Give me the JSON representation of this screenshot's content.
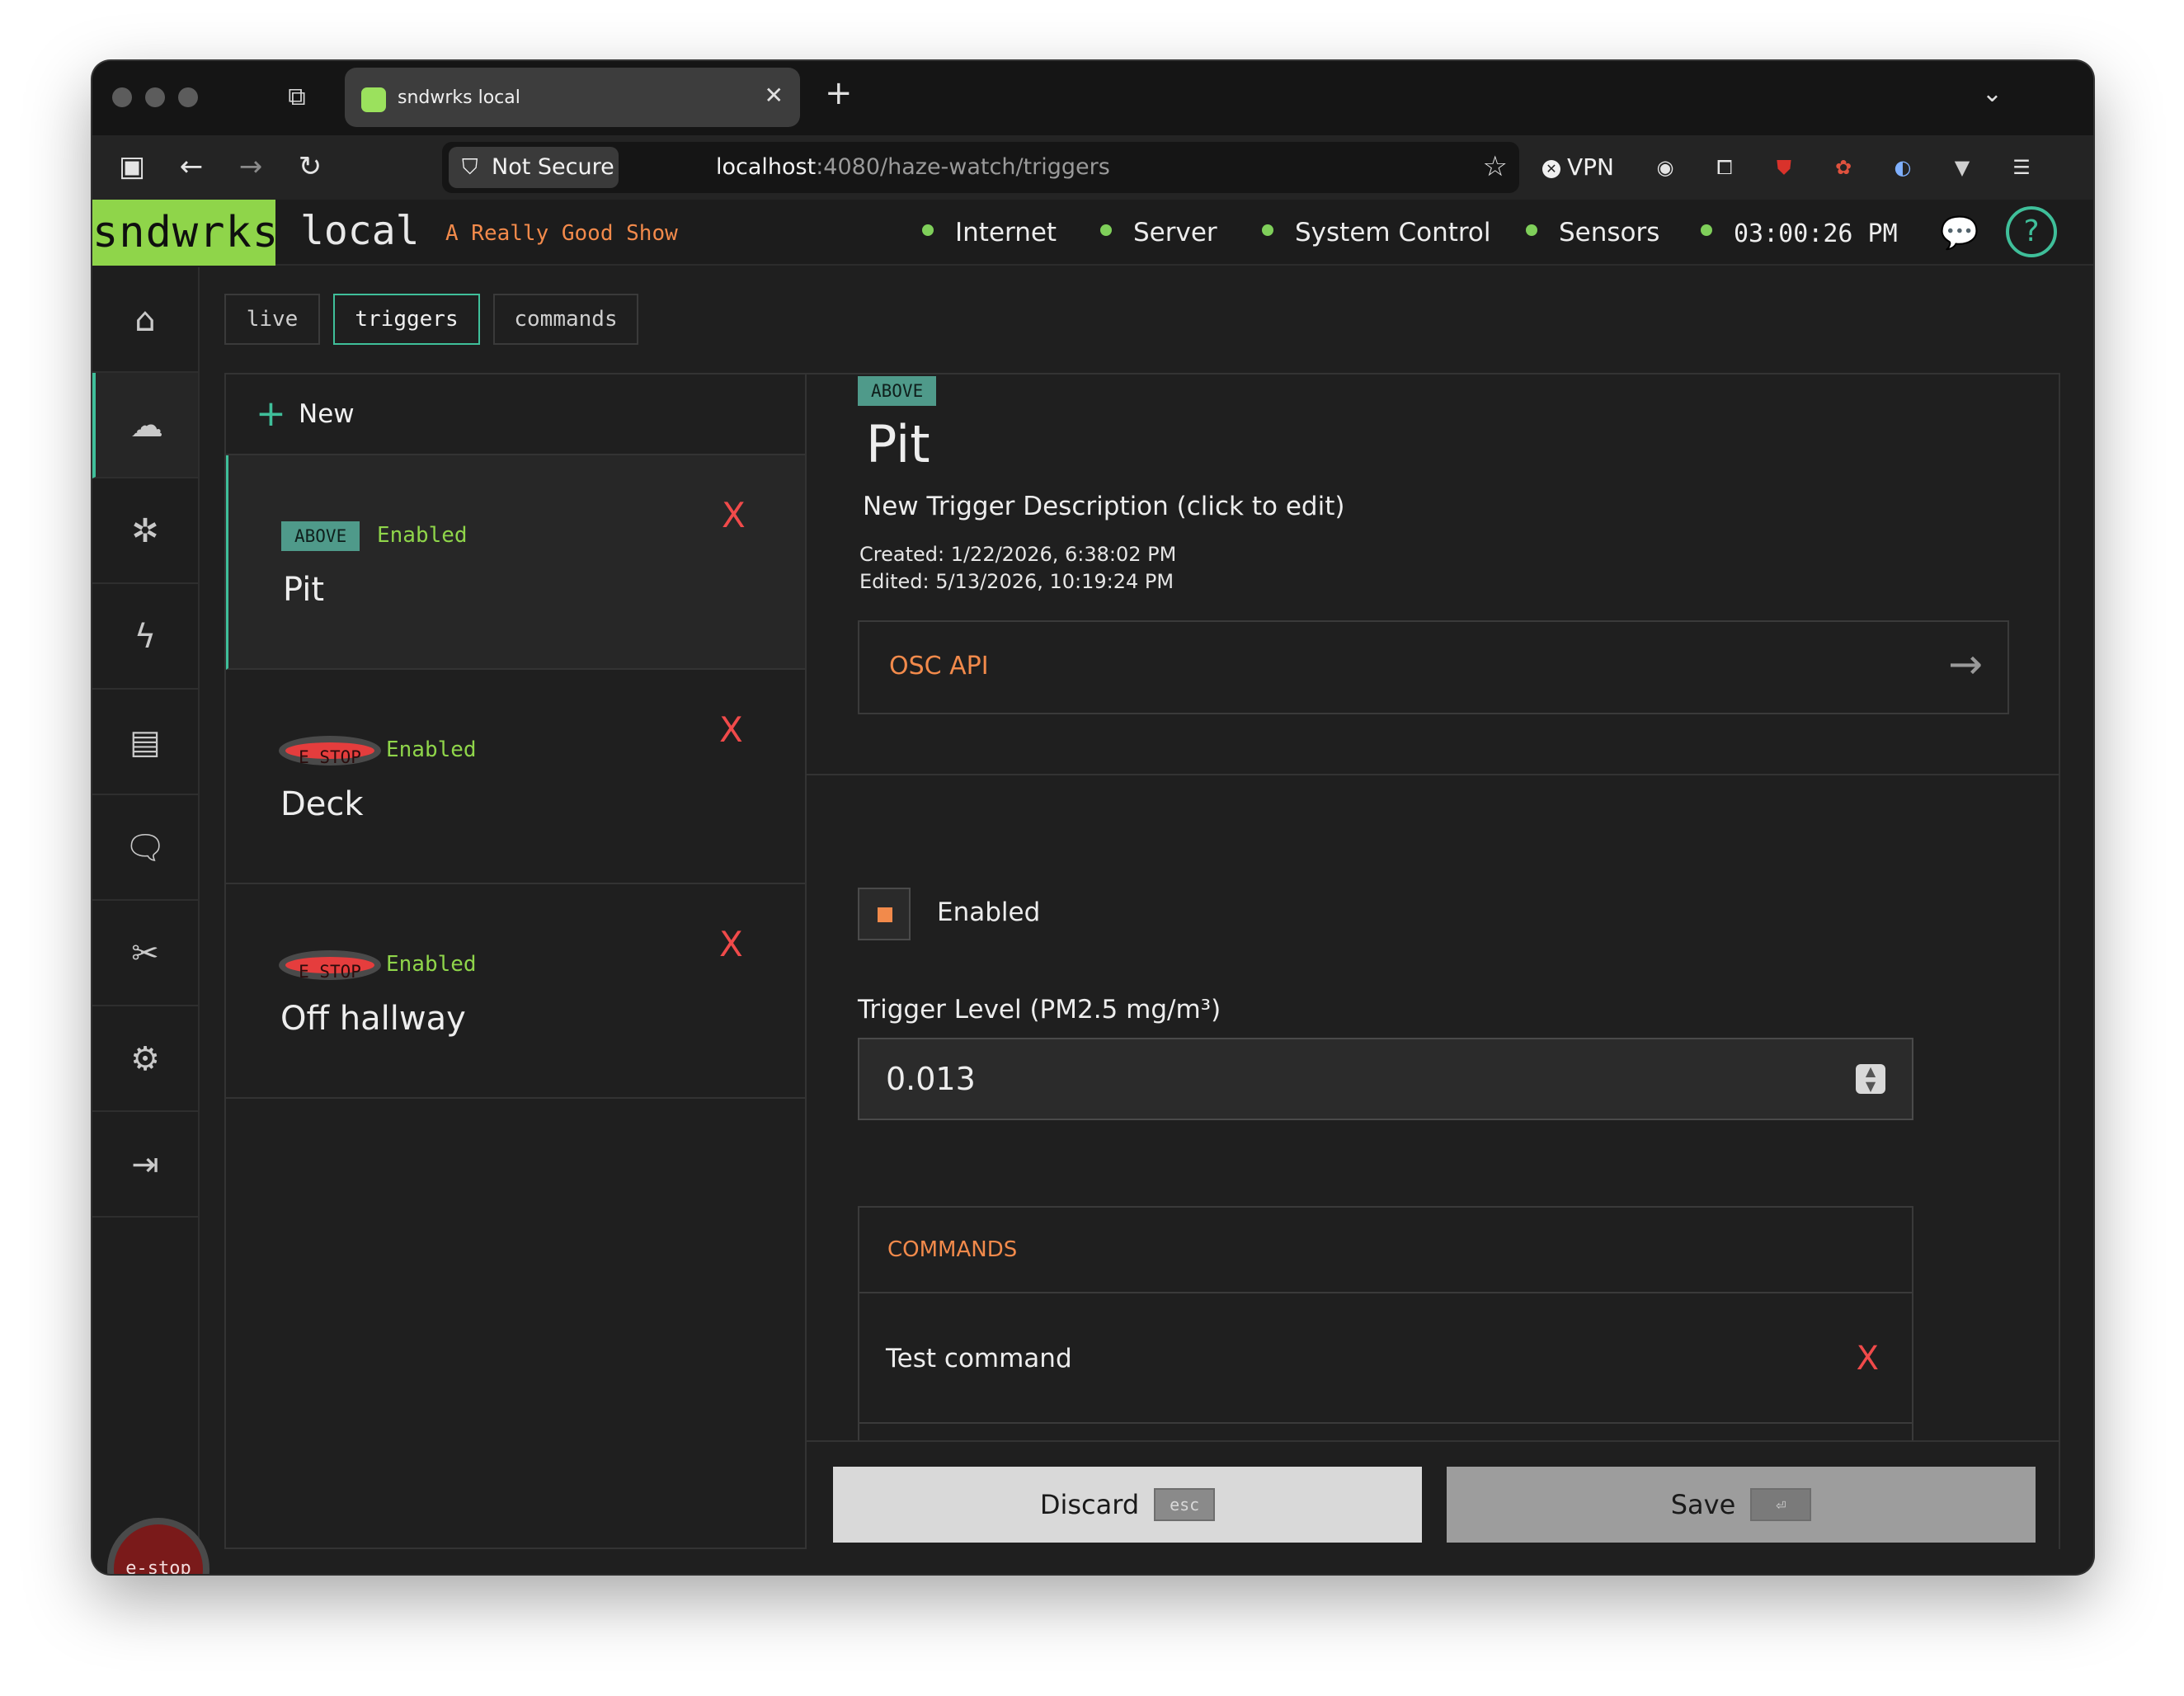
{
  "browser": {
    "tab_title": "sndwrks local",
    "tab_close": "✕",
    "new_tab": "+",
    "not_secure": "Not Secure",
    "url_host": "localhost",
    "url_path": ":4080/haze-watch/triggers",
    "vpn_label": "VPN"
  },
  "header": {
    "brand": "sndwrks",
    "brand_sub": "local",
    "tagline": "A Really Good Show",
    "statuses": [
      "Internet",
      "Server",
      "System Control",
      "Sensors"
    ],
    "clock": "03:00:26 PM",
    "help": "?",
    "status_color": "#7fcf5a",
    "accent_color": "#3fbf9a",
    "brand_color": "#8fd54a"
  },
  "sidenav": {
    "icons": [
      "home-icon",
      "haze-icon",
      "network-icon",
      "lightning-icon",
      "device-icon",
      "chat-icon",
      "tools-icon",
      "gear-icon",
      "logout-icon"
    ],
    "estop_label": "e-stop"
  },
  "page_tabs": [
    "live",
    "triggers",
    "commands"
  ],
  "list": {
    "new_label": "New",
    "triggers": [
      {
        "badge": "ABOVE",
        "status": "Enabled",
        "name": "Pit",
        "delete": "X"
      },
      {
        "badge": "E STOP",
        "status": "Enabled",
        "name": "Deck",
        "delete": "X"
      },
      {
        "badge": "E STOP",
        "status": "Enabled",
        "name": "Off hallway",
        "delete": "X"
      }
    ]
  },
  "detail": {
    "badge": "ABOVE",
    "title": "Pit",
    "description": "New Trigger Description (click to edit)",
    "created": "Created: 1/22/2026, 6:38:02 PM",
    "edited": "Edited: 5/13/2026, 10:19:24 PM",
    "osc_label": "OSC API",
    "enabled_label": "Enabled",
    "enabled": true,
    "level_label": "Trigger Level (PM2.5 mg/m³)",
    "level_value": "0.013",
    "commands_header": "COMMANDS",
    "commands": [
      {
        "name": "Test command",
        "delete": "X"
      }
    ],
    "discard_label": "Discard",
    "discard_key": "esc",
    "save_label": "Save",
    "save_key": "⏎"
  }
}
